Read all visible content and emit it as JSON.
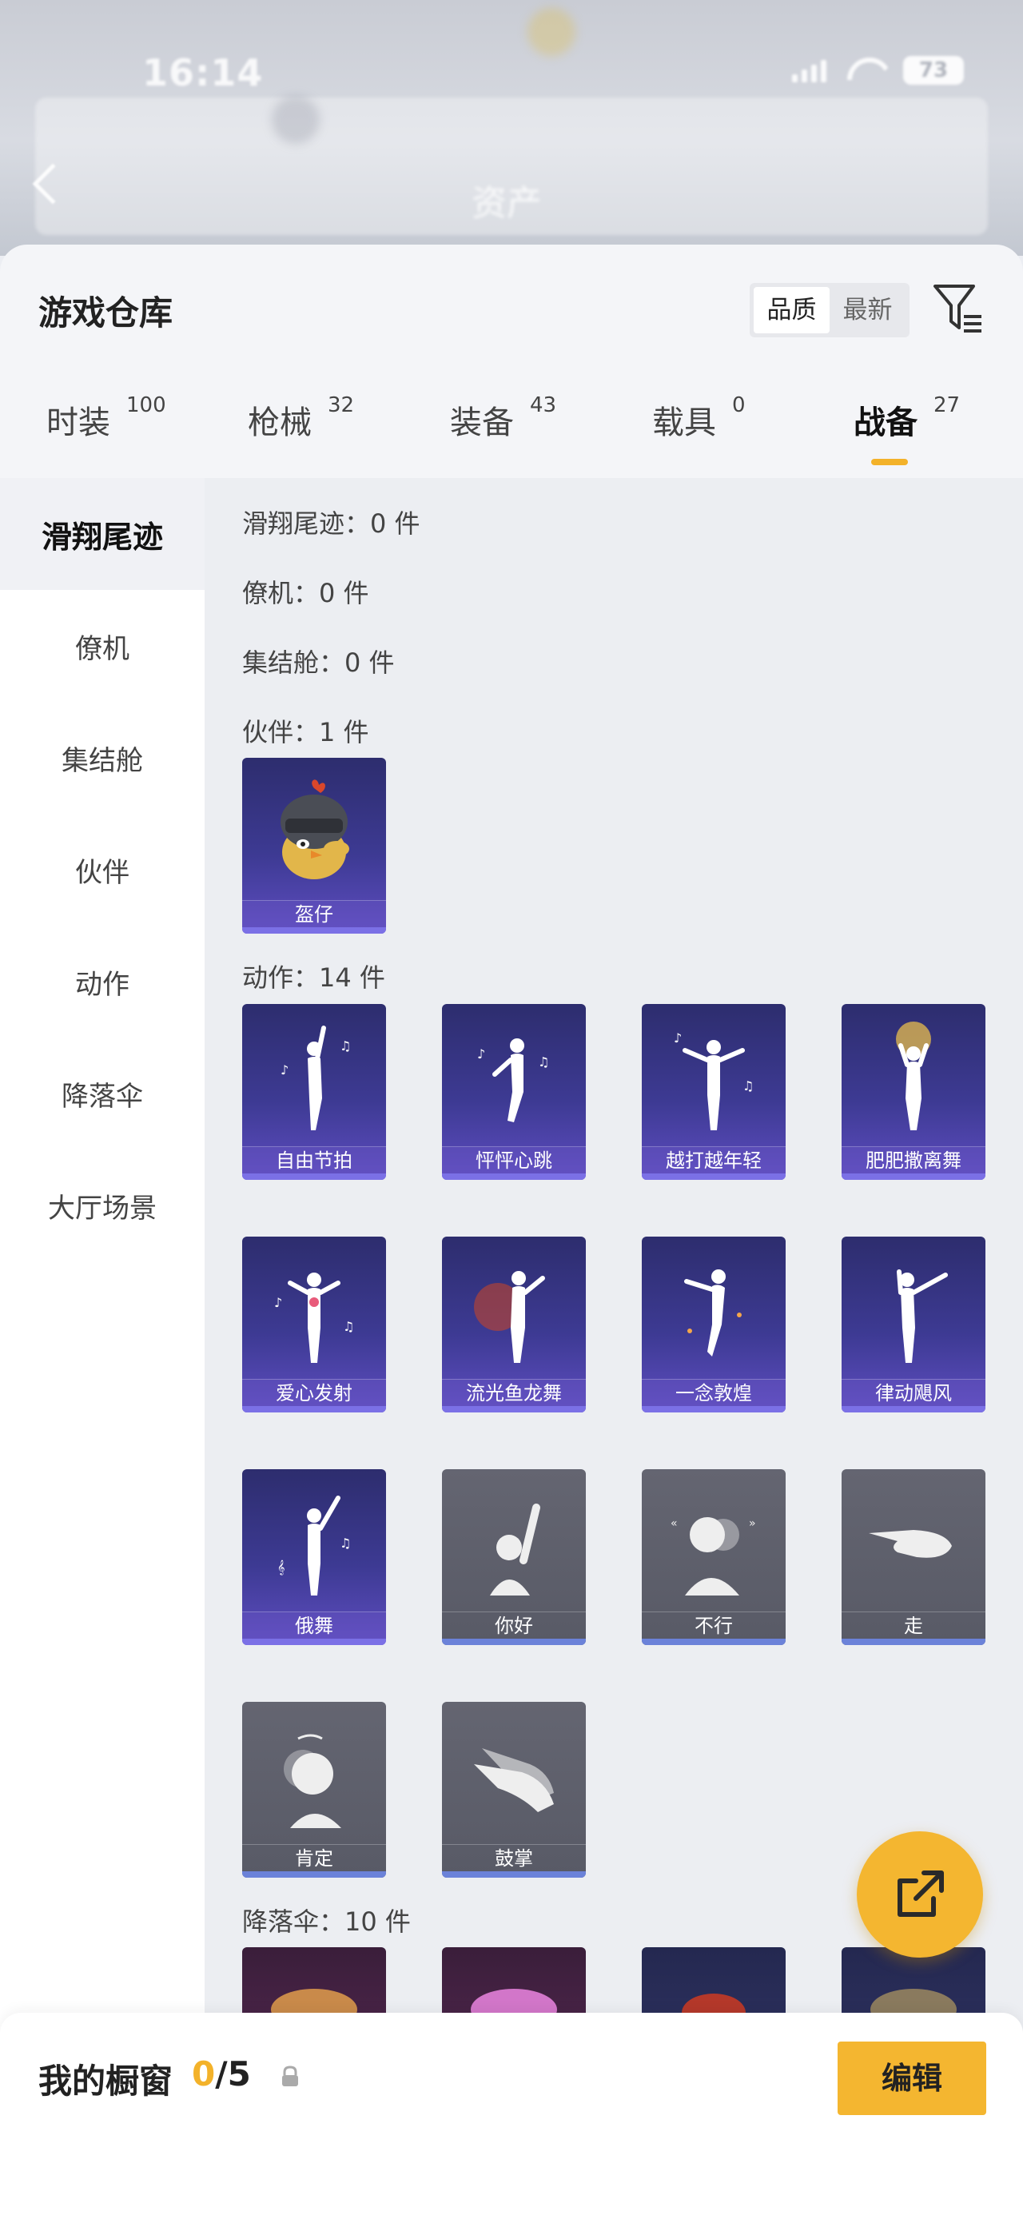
{
  "status_bar": {
    "time": "16:14",
    "battery": "73"
  },
  "header": {
    "ghost_title": "资产"
  },
  "sheet": {
    "title": "游戏仓库",
    "sort": {
      "options": [
        "品质",
        "最新"
      ],
      "selected": "品质"
    }
  },
  "tabs": [
    {
      "label": "时装",
      "count": "100"
    },
    {
      "label": "枪械",
      "count": "32"
    },
    {
      "label": "装备",
      "count": "43"
    },
    {
      "label": "载具",
      "count": "0"
    },
    {
      "label": "战备",
      "count": "27",
      "active": true
    }
  ],
  "sidenav": {
    "items": [
      "滑翔尾迹",
      "僚机",
      "集结舱",
      "伙伴",
      "动作",
      "降落伞",
      "大厅场景"
    ],
    "active": "滑翔尾迹"
  },
  "sections": {
    "glide": "滑翔尾迹：0 件",
    "wingman": "僚机：0 件",
    "pod": "集结舱：0 件",
    "partner": "伙伴：1 件",
    "emote": "动作：14 件",
    "parachute": "降落伞：10 件"
  },
  "partner_items": [
    {
      "name": "盔仔"
    }
  ],
  "emote_items": [
    {
      "name": "自由节拍",
      "style": "purple"
    },
    {
      "name": "怦怦心跳",
      "style": "purple"
    },
    {
      "name": "越打越年轻",
      "style": "purple"
    },
    {
      "name": "肥肥撒离舞",
      "style": "purple"
    },
    {
      "name": "爱心发射",
      "style": "purple"
    },
    {
      "name": "流光鱼龙舞",
      "style": "purple"
    },
    {
      "name": "一念敦煌",
      "style": "purple"
    },
    {
      "name": "律动飓风",
      "style": "purple"
    },
    {
      "name": "俄舞",
      "style": "purple"
    },
    {
      "name": "你好",
      "style": "gray"
    },
    {
      "name": "不行",
      "style": "gray"
    },
    {
      "name": "走",
      "style": "gray"
    },
    {
      "name": "肯定",
      "style": "gray"
    },
    {
      "name": "鼓掌",
      "style": "gray"
    }
  ],
  "bottom_bar": {
    "label": "我的橱窗",
    "current": "0",
    "total": "/5",
    "edit_label": "编辑"
  },
  "icons": {
    "filter": "filter-icon",
    "share": "share-icon",
    "lock": "lock-icon",
    "back": "back-chevron-icon"
  },
  "colors": {
    "accent": "#f3b22a",
    "card_purple": "#3d3a93",
    "card_gray": "#5f606c"
  }
}
